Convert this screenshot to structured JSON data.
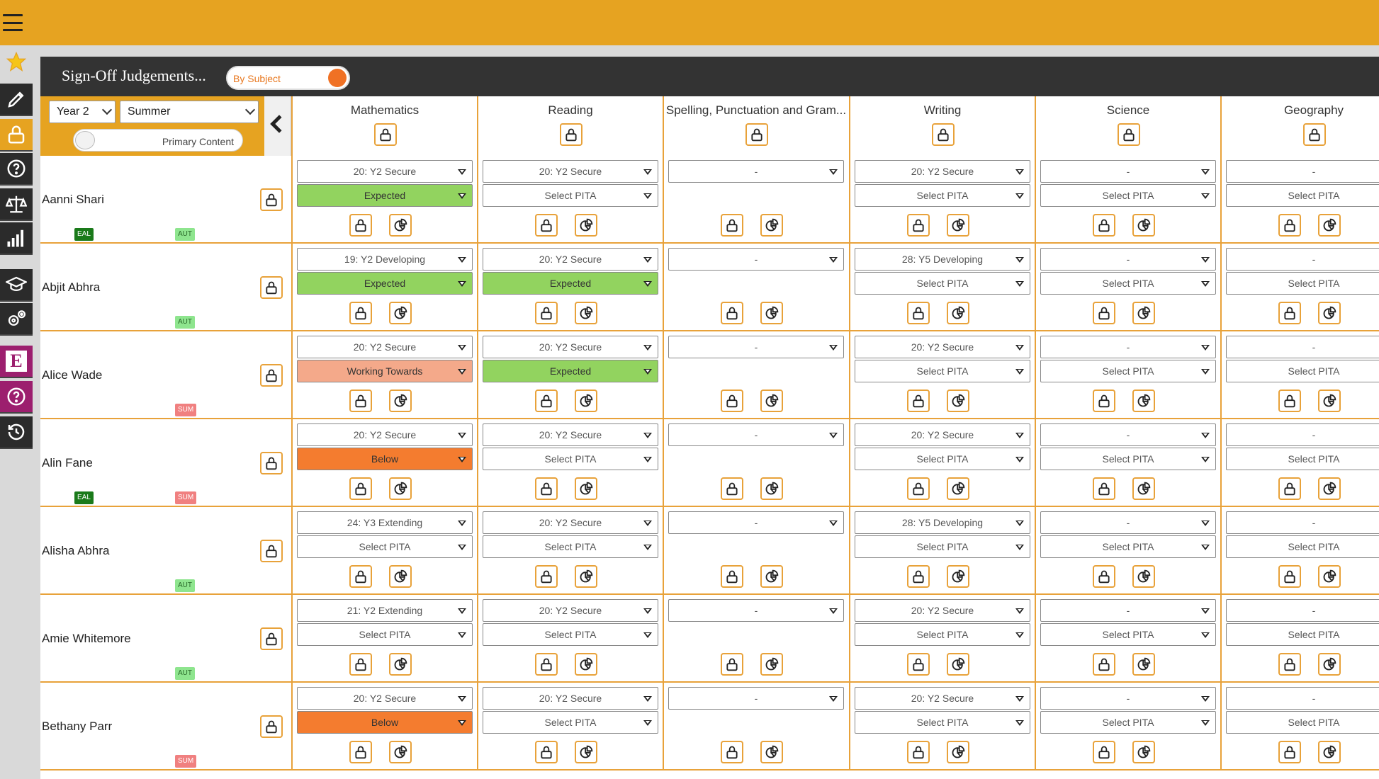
{
  "colors": {
    "accent": "#e6a321",
    "header_dark": "#333333",
    "expected": "#92d35f",
    "working_towards": "#f4a98a",
    "below": "#f47c2f",
    "eal": "#1a7a1a",
    "aut": "#8ee58e",
    "sum": "#f08080"
  },
  "sidebar": {
    "items": [
      {
        "icon": "star-icon"
      },
      {
        "icon": "pencil-icon"
      },
      {
        "icon": "lock-icon"
      },
      {
        "icon": "help-icon"
      },
      {
        "icon": "balance-scale-icon"
      },
      {
        "icon": "signal-bars-icon"
      },
      {
        "icon": "graduation-cap-icon"
      },
      {
        "icon": "settings-gears-icon"
      },
      {
        "icon": "e-logo-icon",
        "label": "E"
      },
      {
        "icon": "help-circle-icon"
      },
      {
        "icon": "history-icon"
      }
    ]
  },
  "header": {
    "title": "Sign-Off Judgements...",
    "mode_toggle": "By Subject"
  },
  "filters": {
    "year": "Year 2",
    "term": "Summer",
    "content_toggle": "Primary Content"
  },
  "subjects": [
    "Mathematics",
    "Reading",
    "Spelling, Punctuation and Gram...",
    "Writing",
    "Science",
    "Geography"
  ],
  "students": [
    {
      "name": "Aanni Shari",
      "eal": "EAL",
      "term_tag": "AUT",
      "cells": [
        {
          "attainment": "20: Y2 Secure",
          "pita": "Expected",
          "pita_color": "green"
        },
        {
          "attainment": "20: Y2 Secure",
          "pita": "Select PITA",
          "pita_color": ""
        },
        {
          "attainment": "-",
          "pita": null,
          "pita_color": ""
        },
        {
          "attainment": "20: Y2 Secure",
          "pita": "Select PITA",
          "pita_color": ""
        },
        {
          "attainment": "-",
          "pita": "Select PITA",
          "pita_color": ""
        },
        {
          "attainment": "-",
          "pita": "Select PITA",
          "pita_color": ""
        }
      ]
    },
    {
      "name": "Abjit Abhra",
      "eal": "",
      "term_tag": "AUT",
      "cells": [
        {
          "attainment": "19: Y2 Developing",
          "pita": "Expected",
          "pita_color": "green"
        },
        {
          "attainment": "20: Y2 Secure",
          "pita": "Expected",
          "pita_color": "green"
        },
        {
          "attainment": "-",
          "pita": null,
          "pita_color": ""
        },
        {
          "attainment": "28: Y5 Developing",
          "pita": "Select PITA",
          "pita_color": ""
        },
        {
          "attainment": "-",
          "pita": "Select PITA",
          "pita_color": ""
        },
        {
          "attainment": "-",
          "pita": "Select PITA",
          "pita_color": ""
        }
      ]
    },
    {
      "name": "Alice Wade",
      "eal": "",
      "term_tag": "SUM",
      "cells": [
        {
          "attainment": "20: Y2 Secure",
          "pita": "Working Towards",
          "pita_color": "salmon"
        },
        {
          "attainment": "20: Y2 Secure",
          "pita": "Expected",
          "pita_color": "green"
        },
        {
          "attainment": "-",
          "pita": null,
          "pita_color": ""
        },
        {
          "attainment": "20: Y2 Secure",
          "pita": "Select PITA",
          "pita_color": ""
        },
        {
          "attainment": "-",
          "pita": "Select PITA",
          "pita_color": ""
        },
        {
          "attainment": "-",
          "pita": "Select PITA",
          "pita_color": ""
        }
      ]
    },
    {
      "name": "Alin Fane",
      "eal": "EAL",
      "term_tag": "SUM",
      "cells": [
        {
          "attainment": "20: Y2 Secure",
          "pita": "Below",
          "pita_color": "orange"
        },
        {
          "attainment": "20: Y2 Secure",
          "pita": "Select PITA",
          "pita_color": ""
        },
        {
          "attainment": "-",
          "pita": null,
          "pita_color": ""
        },
        {
          "attainment": "20: Y2 Secure",
          "pita": "Select PITA",
          "pita_color": ""
        },
        {
          "attainment": "-",
          "pita": "Select PITA",
          "pita_color": ""
        },
        {
          "attainment": "-",
          "pita": "Select PITA",
          "pita_color": ""
        }
      ]
    },
    {
      "name": "Alisha Abhra",
      "eal": "",
      "term_tag": "AUT",
      "cells": [
        {
          "attainment": "24: Y3 Extending",
          "pita": "Select PITA",
          "pita_color": ""
        },
        {
          "attainment": "20: Y2 Secure",
          "pita": "Select PITA",
          "pita_color": ""
        },
        {
          "attainment": "-",
          "pita": null,
          "pita_color": ""
        },
        {
          "attainment": "28: Y5 Developing",
          "pita": "Select PITA",
          "pita_color": ""
        },
        {
          "attainment": "-",
          "pita": "Select PITA",
          "pita_color": ""
        },
        {
          "attainment": "-",
          "pita": "Select PITA",
          "pita_color": ""
        }
      ]
    },
    {
      "name": "Amie Whitemore",
      "eal": "",
      "term_tag": "AUT",
      "cells": [
        {
          "attainment": "21: Y2 Extending",
          "pita": "Select PITA",
          "pita_color": ""
        },
        {
          "attainment": "20: Y2 Secure",
          "pita": "Select PITA",
          "pita_color": ""
        },
        {
          "attainment": "-",
          "pita": null,
          "pita_color": ""
        },
        {
          "attainment": "20: Y2 Secure",
          "pita": "Select PITA",
          "pita_color": ""
        },
        {
          "attainment": "-",
          "pita": "Select PITA",
          "pita_color": ""
        },
        {
          "attainment": "-",
          "pita": "Select PITA",
          "pita_color": ""
        }
      ]
    },
    {
      "name": "Bethany Parr",
      "eal": "",
      "term_tag": "SUM",
      "cells": [
        {
          "attainment": "20: Y2 Secure",
          "pita": "Below",
          "pita_color": "orange"
        },
        {
          "attainment": "20: Y2 Secure",
          "pita": "Select PITA",
          "pita_color": ""
        },
        {
          "attainment": "-",
          "pita": null,
          "pita_color": ""
        },
        {
          "attainment": "20: Y2 Secure",
          "pita": "Select PITA",
          "pita_color": ""
        },
        {
          "attainment": "-",
          "pita": "Select PITA",
          "pita_color": ""
        },
        {
          "attainment": "-",
          "pita": "Select PITA",
          "pita_color": ""
        }
      ]
    }
  ]
}
